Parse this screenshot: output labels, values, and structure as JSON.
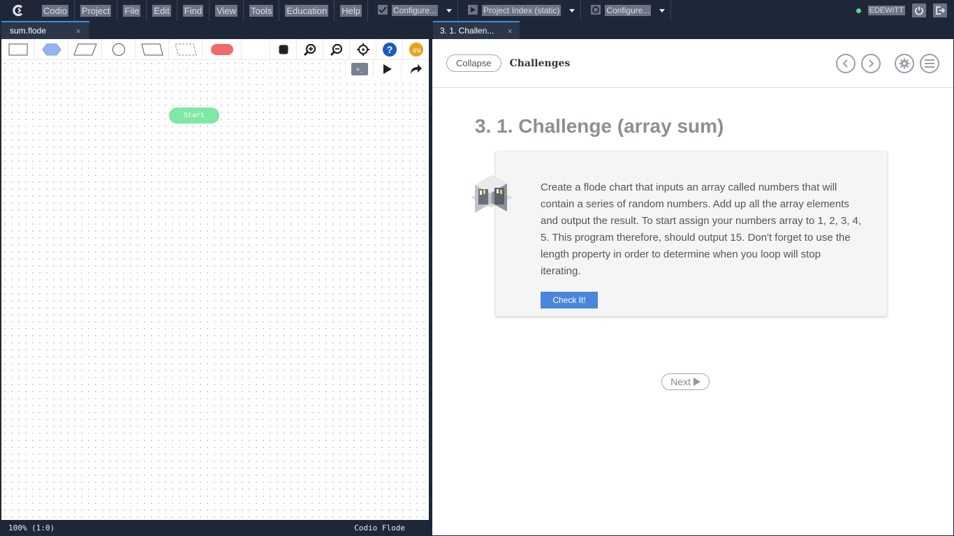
{
  "menubar": {
    "items": [
      "Codio",
      "Project",
      "File",
      "Edit",
      "Find",
      "View",
      "Tools",
      "Education",
      "Help"
    ],
    "configure_label_1": "Configure...",
    "project_index_label": "Project Index (static)",
    "configure_label_2": "Configure...",
    "username": "EDEWITT"
  },
  "left_panel": {
    "tab_label": "sum.flode",
    "tab_close": "×",
    "jpg_label": ".jpg",
    "help_label": "?",
    "terminal_label": ">_",
    "start_node": "Start",
    "status_zoom": "100% (1:0)",
    "status_app": "Codio Flode"
  },
  "right_panel": {
    "tab_label": "3. 1. Challen...",
    "tab_close": "×",
    "collapse_label": "Collapse",
    "guide_title": "Challenges",
    "page_heading": "3. 1. Challenge (array sum)",
    "description": "Create a flode chart that inputs an array called numbers that will contain a series of random numbers. Add up all the array elements and output the result. To start assign your numbers array to 1, 2, 3, 4, 5. This program therefore, should output 15. Don't forget to use the length property in order to determine when you loop will stop iterating.",
    "check_label": "Check It!",
    "next_label": "Next"
  },
  "colors": {
    "chrome": "#1e2738",
    "accent_blue": "#4a86d9",
    "start_green": "#7ee8a6",
    "terminator_red": "#ee6b6b",
    "decision_blue": "#93b4f0",
    "help_blue": "#1a5bbf",
    "jpg_orange": "#e7a21a"
  },
  "icons": [
    "codio-logo-icon",
    "checkmark-icon",
    "play-icon",
    "gear-icon",
    "power-icon",
    "logout-icon",
    "stop-icon",
    "zoom-in-icon",
    "zoom-out-icon",
    "target-icon",
    "help-icon",
    "terminal-icon",
    "redo-icon",
    "chevron-left-icon",
    "chevron-right-icon",
    "settings-icon",
    "menu-icon"
  ]
}
